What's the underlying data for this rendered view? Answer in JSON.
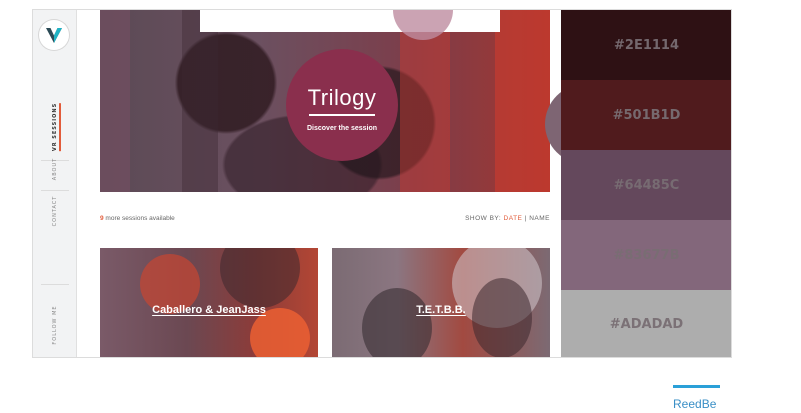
{
  "sidebar": {
    "logo_letter": "V",
    "nav": [
      {
        "label": "VR Sessions"
      },
      {
        "label": "About"
      },
      {
        "label": "Contact"
      }
    ],
    "follow_label": "Follow me"
  },
  "hero": {
    "title": "Trilogy",
    "subtitle": "Discover the session"
  },
  "sessions": {
    "count": "9",
    "count_text": " more sessions available",
    "show_by_label": "SHOW BY:",
    "sort_date": "DATE",
    "sort_sep": "|",
    "sort_name": "NAME"
  },
  "cards": [
    {
      "name": "Caballero & JeanJass"
    },
    {
      "name": "T.E.T.B.B."
    }
  ],
  "palette": [
    {
      "hex": "#2E1114",
      "color": "#2E1114"
    },
    {
      "hex": "#501B1D",
      "color": "#501B1D"
    },
    {
      "hex": "#64485C",
      "color": "#64485C"
    },
    {
      "hex": "#83677B",
      "color": "#83677B"
    },
    {
      "hex": "#ADADAD",
      "color": "#ADADAD"
    }
  ],
  "footer": {
    "brand": "ReedBe"
  }
}
